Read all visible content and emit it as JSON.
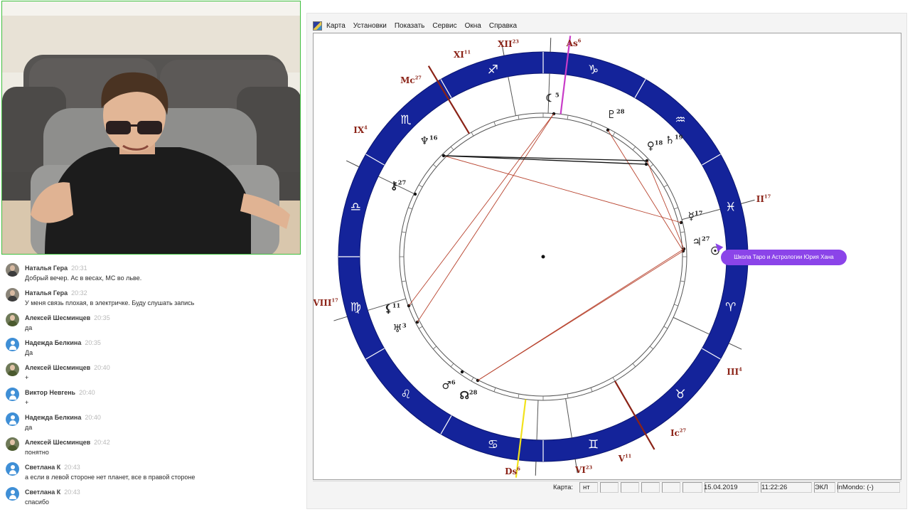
{
  "chat": {
    "messages": [
      {
        "author": "Наталья Гера",
        "time": "20:31",
        "text": "Добрый вечер. Ас в весах, МС во льве.",
        "avatar": "photo"
      },
      {
        "author": "Наталья Гера",
        "time": "20:32",
        "text": "У меня связь плохая, в электричке. Буду слушать запись",
        "avatar": "photo"
      },
      {
        "author": "Алексей Шесминцев",
        "time": "20:35",
        "text": "да",
        "avatar": "photo2"
      },
      {
        "author": "Надежда Белкина",
        "time": "20:35",
        "text": "Да",
        "avatar": "default"
      },
      {
        "author": "Алексей Шесминцев",
        "time": "20:40",
        "text": "+",
        "avatar": "photo2"
      },
      {
        "author": "Виктор Невгень",
        "time": "20:40",
        "text": "+",
        "avatar": "default"
      },
      {
        "author": "Надежда Белкина",
        "time": "20:40",
        "text": "да",
        "avatar": "default"
      },
      {
        "author": "Алексей Шесминцев",
        "time": "20:42",
        "text": "понятно",
        "avatar": "photo2"
      },
      {
        "author": "Светлана К",
        "time": "20:43",
        "text": "а если в левой стороне нет планет, все в правой стороне",
        "avatar": "default"
      },
      {
        "author": "Светлана К",
        "time": "20:43",
        "text": "спасибо",
        "avatar": "default"
      }
    ]
  },
  "menu": {
    "items": [
      "Карта",
      "Установки",
      "Показать",
      "Сервис",
      "Окна",
      "Справка"
    ]
  },
  "status": {
    "label": "Карта:",
    "day": "нт",
    "date": "15.04.2019",
    "time": "11:22:26",
    "mode": "ЭКЛ",
    "extra": "InMondo: (-)"
  },
  "tooltip": "Школа Таро и Астрологии Юрия Хана",
  "colors": {
    "zodiac_ring": "#14239a",
    "aspect_red": "#b8442f",
    "aspect_black": "#111111",
    "axis_magenta": "#c83cc8",
    "axis_yellow": "#f2e21c",
    "axis_darkred": "#8b2317",
    "tooltip_bg": "#8b44e9"
  },
  "chart": {
    "signs": [
      {
        "name": "Овен",
        "glyph": "♈",
        "icon": "aries-icon"
      },
      {
        "name": "Телец",
        "glyph": "♉",
        "icon": "taurus-icon"
      },
      {
        "name": "Близнецы",
        "glyph": "♊",
        "icon": "gemini-icon"
      },
      {
        "name": "Рак",
        "glyph": "♋",
        "icon": "cancer-icon"
      },
      {
        "name": "Лев",
        "glyph": "♌",
        "icon": "leo-icon"
      },
      {
        "name": "Дева",
        "glyph": "♍",
        "icon": "virgo-icon"
      },
      {
        "name": "Весы",
        "glyph": "♎",
        "icon": "libra-icon"
      },
      {
        "name": "Скорпион",
        "glyph": "♏",
        "icon": "scorpio-icon"
      },
      {
        "name": "Стрелец",
        "glyph": "♐",
        "icon": "sagittarius-icon"
      },
      {
        "name": "Козерог",
        "glyph": "♑",
        "icon": "capricorn-icon"
      },
      {
        "name": "Водолей",
        "glyph": "♒",
        "icon": "aquarius-icon"
      },
      {
        "name": "Рыбы",
        "glyph": "♓",
        "icon": "pisces-icon"
      }
    ],
    "houses": [
      {
        "label": "As",
        "deg": "6"
      },
      {
        "label": "II",
        "deg": "17"
      },
      {
        "label": "III",
        "deg": "4"
      },
      {
        "label": "Ic",
        "deg": "27"
      },
      {
        "label": "V",
        "deg": "11"
      },
      {
        "label": "VI",
        "deg": "23"
      },
      {
        "label": "Ds",
        "deg": "6"
      },
      {
        "label": "VIII",
        "deg": "17"
      },
      {
        "label": "IX",
        "deg": "4"
      },
      {
        "label": "Mc",
        "deg": "27"
      },
      {
        "label": "XI",
        "deg": "11"
      },
      {
        "label": "XII",
        "deg": "23"
      }
    ],
    "planets": [
      {
        "name": "moon",
        "glyph": "☾",
        "deg": "5",
        "icon": "moon-icon"
      },
      {
        "name": "pluto",
        "glyph": "♇",
        "deg": "28",
        "icon": "pluto-icon"
      },
      {
        "name": "venus",
        "glyph": "♀",
        "deg": "18",
        "icon": "venus-icon"
      },
      {
        "name": "saturn",
        "glyph": "♄",
        "deg": "19",
        "icon": "saturn-icon"
      },
      {
        "name": "mercury",
        "glyph": "☿",
        "deg": "17",
        "icon": "mercury-icon"
      },
      {
        "name": "jupiter",
        "glyph": "♃",
        "deg": "27",
        "icon": "jupiter-icon"
      },
      {
        "name": "sun",
        "glyph": "☉",
        "deg": "",
        "icon": "sun-icon"
      },
      {
        "name": "neptune",
        "glyph": "♆",
        "deg": "16",
        "icon": "neptune-icon"
      },
      {
        "name": "chiron",
        "glyph": "⚷",
        "deg": "27",
        "icon": "chiron-icon"
      },
      {
        "name": "lilith",
        "glyph": "⚸",
        "deg": "11",
        "icon": "lilith-icon"
      },
      {
        "name": "uranus",
        "glyph": "♅",
        "deg": "3",
        "icon": "uranus-icon"
      },
      {
        "name": "mars",
        "glyph": "♂",
        "deg": "6",
        "icon": "mars-icon"
      },
      {
        "name": "north-node",
        "glyph": "☊",
        "deg": "28",
        "icon": "north-node-icon"
      }
    ]
  }
}
